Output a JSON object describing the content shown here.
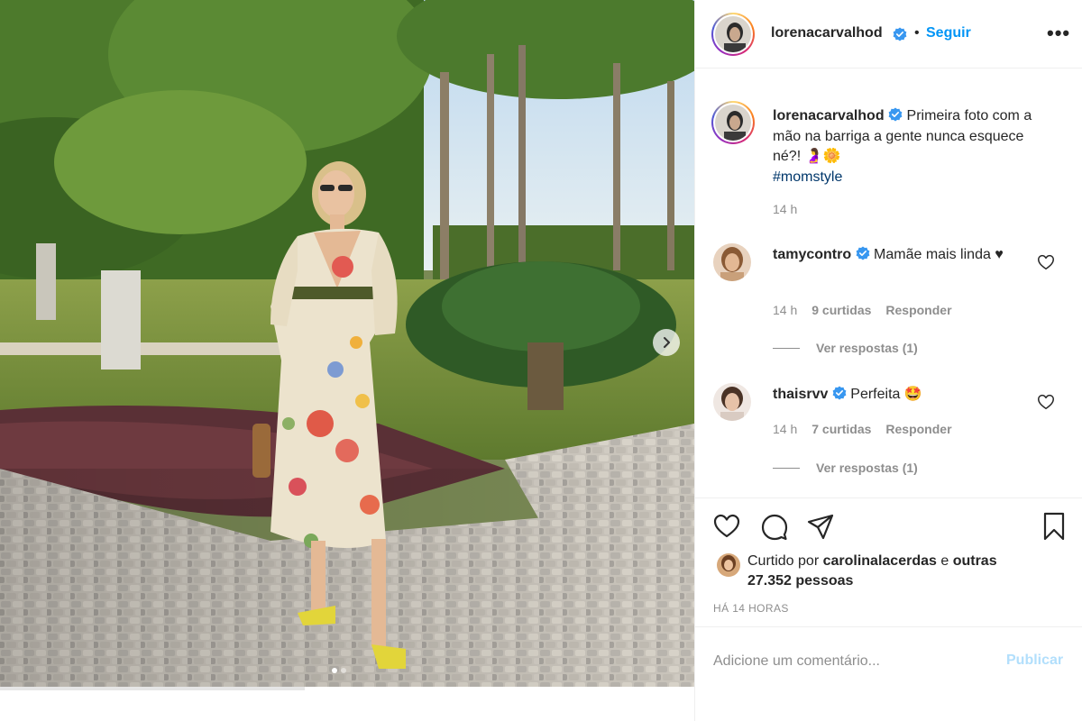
{
  "post": {
    "image_alt": "",
    "carousel": {
      "current": 1,
      "total": 2
    }
  },
  "header": {
    "username": "lorenacarvalhod",
    "separator": "•",
    "follow_label": "Seguir",
    "more_label": "•••"
  },
  "caption": {
    "username": "lorenacarvalhod",
    "text": "Primeira foto com a mão na barriga a gente nunca esquece né?! 🤰🌼",
    "hashtag": "#momstyle",
    "time": "14 h"
  },
  "comments": [
    {
      "username": "tamycontro",
      "text": "Mamãe mais linda ♥",
      "time": "14 h",
      "likes": "9 curtidas",
      "reply_label": "Responder",
      "view_replies": "Ver respostas (1)"
    },
    {
      "username": "thaisrvv",
      "text": "Perfeita 🤩",
      "time": "14 h",
      "likes": "7 curtidas",
      "reply_label": "Responder",
      "view_replies": "Ver respostas (1)"
    }
  ],
  "likes": {
    "prefix": "Curtido por ",
    "user": "carolinalacerdas",
    "middle": " e ",
    "others": "outras 27.352 pessoas"
  },
  "post_time": "HÁ 14 HORAS",
  "add_comment": {
    "placeholder": "Adicione um comentário...",
    "publish_label": "Publicar"
  },
  "colors": {
    "accent": "#0095f6",
    "link": "#00376b",
    "muted": "#8e8e8e",
    "publish_disabled": "#b2dffc"
  }
}
